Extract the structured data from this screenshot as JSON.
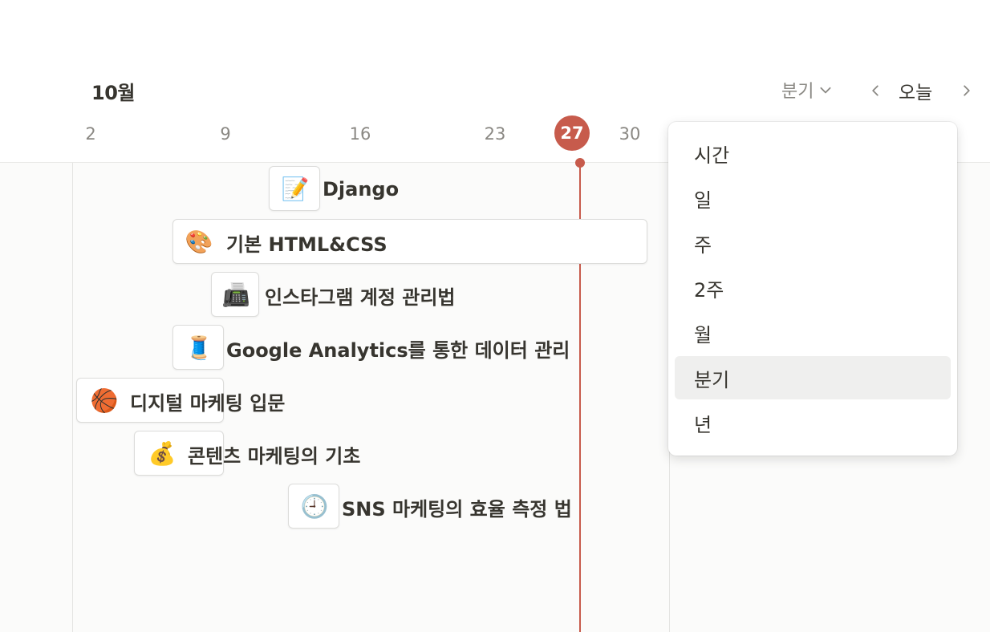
{
  "header": {
    "month": "10월",
    "view_label": "분기",
    "today_label": "오늘"
  },
  "dates": [
    "2",
    "9",
    "16",
    "23",
    "27",
    "30"
  ],
  "today": "27",
  "items": [
    {
      "icon": "📝",
      "icon_name": "memo-icon",
      "title": "Django"
    },
    {
      "icon": "🎨",
      "icon_name": "palette-icon",
      "title": "기본 HTML&CSS"
    },
    {
      "icon": "📠",
      "icon_name": "fax-icon",
      "title": "인스타그램 계정 관리법"
    },
    {
      "icon": "🧵",
      "icon_name": "thread-spool-icon",
      "title": "Google Analytics를 통한 데이터 관리"
    },
    {
      "icon": "🏀",
      "icon_name": "basketball-icon",
      "title": "디지털 마케팅 입문"
    },
    {
      "icon": "💰",
      "icon_name": "money-bag-icon",
      "title": "콘텐츠 마케팅의 기초"
    },
    {
      "icon": "🕘",
      "icon_name": "clock-icon",
      "title": "SNS 마케팅의 효율 측정 법"
    }
  ],
  "view_menu": {
    "options": [
      "시간",
      "일",
      "주",
      "2주",
      "월",
      "분기",
      "년"
    ],
    "selected": "분기"
  },
  "colors": {
    "today_accent": "#c75b4c",
    "selected_bg": "#efefee",
    "muted_text": "#8a8883"
  }
}
